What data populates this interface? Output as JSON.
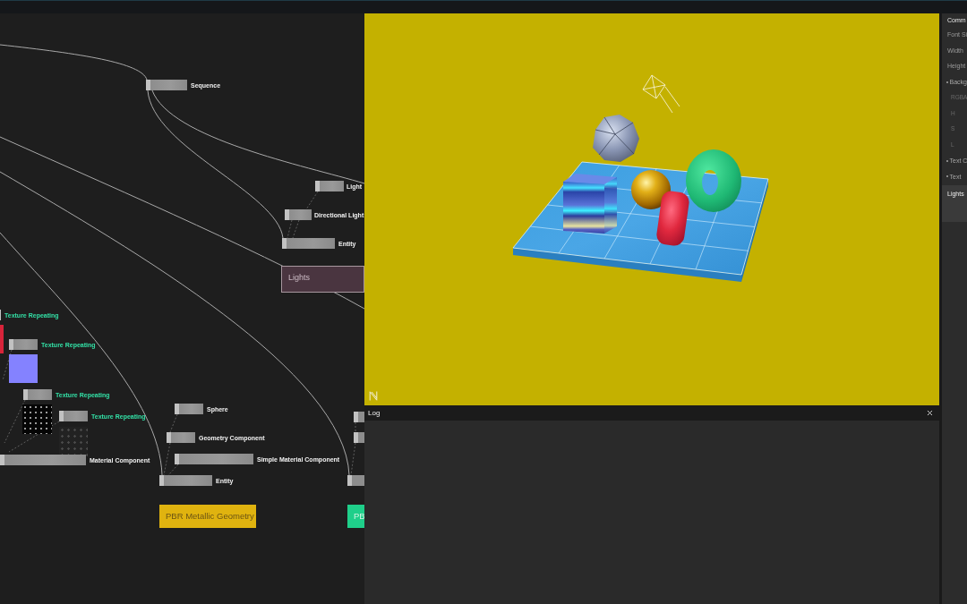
{
  "node_graph": {
    "nodes": [
      {
        "label": "Sequence",
        "kind": "node"
      },
      {
        "label": "Light",
        "kind": "node"
      },
      {
        "label": "Directional Light",
        "kind": "node"
      },
      {
        "label": "Entity",
        "kind": "node"
      },
      {
        "label": "Texture Repeating",
        "kind": "texture"
      },
      {
        "label": "Texture Repeating",
        "kind": "texture"
      },
      {
        "label": "Texture Repeating",
        "kind": "texture"
      },
      {
        "label": "Texture Repeating",
        "kind": "texture"
      },
      {
        "label": "Material Component",
        "kind": "node"
      },
      {
        "label": "Sphere",
        "kind": "node"
      },
      {
        "label": "Geometry Component",
        "kind": "node"
      },
      {
        "label": "Simple Material Component",
        "kind": "node"
      },
      {
        "label": "Entity",
        "kind": "node"
      }
    ],
    "comments": [
      {
        "label": "Lights",
        "color": "#4a3540"
      },
      {
        "label": "PBR Metallic Geometry",
        "color": "#e0b30f"
      },
      {
        "label": "PB",
        "color": "#1fcf8a"
      }
    ]
  },
  "log_panel": {
    "title": "Log"
  },
  "properties_panel": {
    "items": [
      {
        "label": "Comm",
        "kind": "header"
      },
      {
        "label": "Font Si",
        "kind": "field"
      },
      {
        "label": "Width",
        "kind": "field"
      },
      {
        "label": "Height",
        "kind": "field"
      },
      {
        "label": "Backg",
        "kind": "section"
      },
      {
        "label": "RGBA",
        "kind": "sub"
      },
      {
        "label": "H",
        "kind": "sub"
      },
      {
        "label": "S",
        "kind": "sub"
      },
      {
        "label": "L",
        "kind": "sub"
      },
      {
        "label": "Text C",
        "kind": "section"
      },
      {
        "label": "Text",
        "kind": "section"
      },
      {
        "value": "Lights",
        "kind": "textarea"
      }
    ]
  }
}
